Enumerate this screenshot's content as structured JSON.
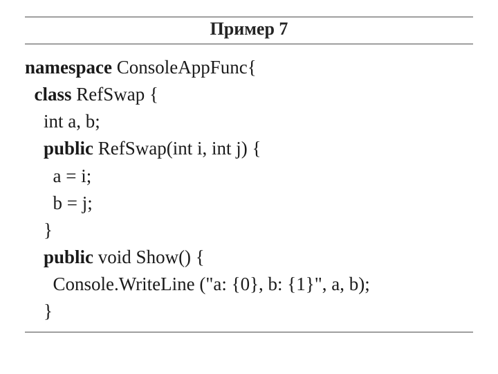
{
  "title": "Пример 7",
  "code": {
    "kw_namespace": "namespace",
    "ns_name": " ConsoleAppFunc{",
    "kw_class": "class",
    "class_name": " RefSwap {",
    "fields": "    int a, b;",
    "kw_public1": "public",
    "ctor_sig": " RefSwap(int i, int j) {",
    "ctor_l1": "      a = i;",
    "ctor_l2": "      b = j;",
    "ctor_close": "    }",
    "kw_public2": "public",
    "show_sig": " void Show() {",
    "show_body": "      Console.WriteLine (\"a: {0}, b: {1}\", a, b);",
    "show_close": "    }"
  }
}
